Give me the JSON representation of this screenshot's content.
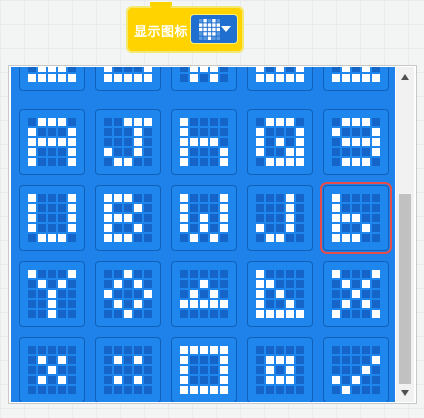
{
  "block": {
    "label": "显示图标",
    "selected_icon": "heart-icon",
    "color": "#ffd300"
  },
  "dropdown_panel": {
    "selected_index": 14,
    "icons": [
      {
        "name": "icon-partial-1",
        "rows": [
          "00000",
          "00000",
          "00000",
          "01110",
          "11111"
        ]
      },
      {
        "name": "icon-partial-2",
        "rows": [
          "00000",
          "00000",
          "00000",
          "10001",
          "11111"
        ]
      },
      {
        "name": "icon-partial-3",
        "rows": [
          "00000",
          "00000",
          "00000",
          "01110",
          "01010"
        ]
      },
      {
        "name": "icon-partial-4",
        "rows": [
          "00000",
          "00000",
          "00000",
          "10101",
          "11111"
        ]
      },
      {
        "name": "icon-partial-5",
        "rows": [
          "00000",
          "00000",
          "00000",
          "01010",
          "11111"
        ]
      },
      {
        "name": "letter-a-icon",
        "rows": [
          "01110",
          "10001",
          "11111",
          "10001",
          "10001"
        ]
      },
      {
        "name": "letter-j-icon",
        "rows": [
          "00111",
          "00010",
          "00010",
          "10010",
          "01100"
        ]
      },
      {
        "name": "letter-h-icon",
        "rows": [
          "10000",
          "10000",
          "11110",
          "10001",
          "10001"
        ]
      },
      {
        "name": "letter-q-icon",
        "rows": [
          "01110",
          "10001",
          "10101",
          "10011",
          "01111"
        ]
      },
      {
        "name": "digit-9-icon",
        "rows": [
          "01110",
          "10001",
          "01111",
          "00001",
          "01110"
        ]
      },
      {
        "name": "letter-u-icon",
        "rows": [
          "10001",
          "10001",
          "10001",
          "10001",
          "01110"
        ]
      },
      {
        "name": "letter-b-icon",
        "rows": [
          "11100",
          "10010",
          "11100",
          "10010",
          "11100"
        ]
      },
      {
        "name": "letter-w-icon",
        "rows": [
          "10001",
          "10001",
          "10101",
          "10101",
          "01010"
        ]
      },
      {
        "name": "letter-j-small-icon",
        "rows": [
          "00010",
          "00010",
          "00010",
          "10010",
          "01100"
        ]
      },
      {
        "name": "letter-b-small-icon",
        "rows": [
          "10000",
          "10000",
          "11100",
          "10010",
          "11100"
        ]
      },
      {
        "name": "letter-y-icon",
        "rows": [
          "10001",
          "01010",
          "00100",
          "00100",
          "00100"
        ]
      },
      {
        "name": "ring-icon",
        "rows": [
          "00100",
          "01010",
          "10001",
          "01010",
          "00100"
        ]
      },
      {
        "name": "triangle-icon",
        "rows": [
          "00000",
          "00100",
          "01010",
          "11111",
          "00000"
        ]
      },
      {
        "name": "corner-icon",
        "rows": [
          "10000",
          "11000",
          "10100",
          "10010",
          "11111"
        ]
      },
      {
        "name": "letter-x-icon",
        "rows": [
          "10001",
          "01010",
          "00100",
          "01010",
          "10001"
        ]
      },
      {
        "name": "diamond-icon",
        "rows": [
          "00000",
          "01010",
          "00100",
          "01010",
          "00000"
        ]
      },
      {
        "name": "dots-icon",
        "rows": [
          "00000",
          "01010",
          "00000",
          "01010",
          "00000"
        ]
      },
      {
        "name": "square-icon",
        "rows": [
          "11111",
          "10001",
          "10001",
          "10001",
          "11111"
        ]
      },
      {
        "name": "small-square-icon",
        "rows": [
          "00000",
          "01110",
          "01010",
          "01110",
          "00000"
        ]
      },
      {
        "name": "check-icon",
        "rows": [
          "00000",
          "00001",
          "00010",
          "10100",
          "01000"
        ]
      }
    ]
  },
  "colors": {
    "panel_bg": "#1e82ea",
    "led_on": "#ffffff",
    "led_off": "#1565c8",
    "selection": "#e74c4c"
  }
}
